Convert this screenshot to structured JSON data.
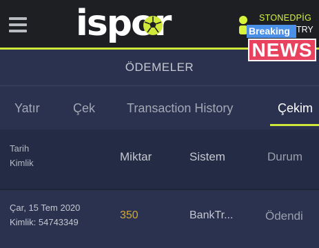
{
  "header": {
    "logo_text": "ispor",
    "username": "STONEDPİG",
    "balance": "TRY"
  },
  "watermark": {
    "line1": "Breaking",
    "line2": "NEWS"
  },
  "page": {
    "title": "ÖDEMELER"
  },
  "tabs": [
    {
      "label": "Yatır"
    },
    {
      "label": "Çek"
    },
    {
      "label": "Transaction History"
    },
    {
      "label": "Çekim"
    }
  ],
  "active_tab": "Çekim",
  "table": {
    "headers": {
      "date": "Tarih",
      "id": "Kimlik",
      "amount": "Miktar",
      "system": "Sistem",
      "status": "Durum"
    },
    "rows": [
      {
        "date": "Çar, 15 Tem 2020",
        "id": "Kimlik: 54743349",
        "amount": "350",
        "system": "BankTr...",
        "status": "Ödendi"
      }
    ]
  },
  "colors": {
    "accent": "#cfe83a",
    "amount": "#d2a93a",
    "background": "#2a3250",
    "topbar": "#1d1f23"
  }
}
